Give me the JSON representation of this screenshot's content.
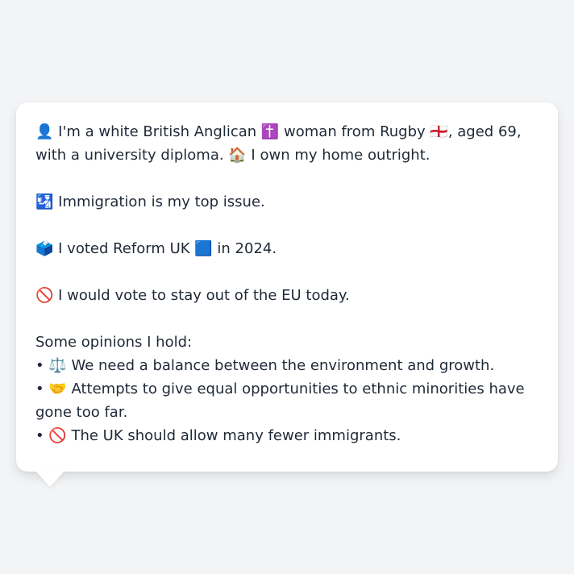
{
  "profile": {
    "intro": "👤 I'm a white British Anglican ✝️ woman from Rugby 🏴󠁧󠁢󠁥󠁮󠁧󠁿, aged 69, with a university diploma. 🏠 I own my home outright.",
    "top_issue": "🛂 Immigration is my top issue.",
    "vote_2024": "🗳️ I voted Reform UK 🟦 in 2024.",
    "eu_stance": "🚫 I would vote to stay out of the EU today."
  },
  "opinions": {
    "heading": "Some opinions I hold:",
    "items": [
      "• ⚖️ We need a balance between the environment and growth.",
      "• 🤝 Attempts to give equal opportunities to ethnic minorities have gone too far.",
      "• 🚫 The UK should allow many fewer immigrants."
    ]
  },
  "colors": {
    "background": "#f3f4f6",
    "bubble": "#ffffff",
    "text": "#1f2937"
  }
}
